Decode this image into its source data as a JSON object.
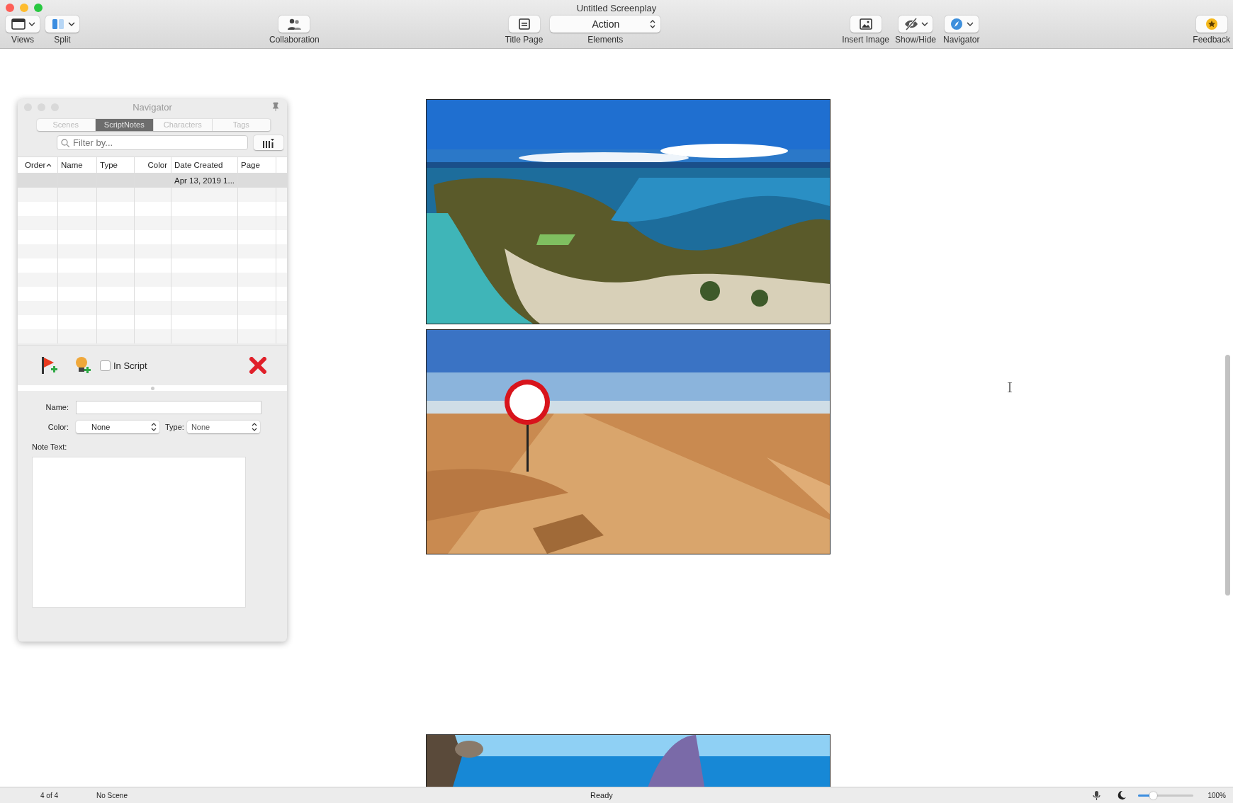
{
  "window": {
    "title": "Untitled Screenplay"
  },
  "toolbar": [
    {
      "kind": "button",
      "label": "Views",
      "menu": true
    },
    {
      "kind": "button",
      "label": "Split",
      "menu": true
    },
    {
      "kind": "button",
      "label": "Collaboration",
      "menu": false
    },
    {
      "kind": "button",
      "label": "Title Page",
      "menu": false
    },
    {
      "kind": "popup",
      "label": "Elements",
      "value": "Action"
    },
    {
      "kind": "button",
      "label": "Insert Image",
      "menu": false
    },
    {
      "kind": "button",
      "label": "Show/Hide",
      "menu": true
    },
    {
      "kind": "button",
      "label": "Navigator",
      "menu": true
    },
    {
      "kind": "button",
      "label": "Feedback",
      "menu": false
    }
  ],
  "navigator": {
    "title": "Navigator",
    "tabs": [
      {
        "label": "Scenes",
        "selected": false
      },
      {
        "label": "ScriptNotes",
        "selected": true
      },
      {
        "label": "Characters",
        "selected": false
      },
      {
        "label": "Tags",
        "selected": false
      }
    ],
    "filter": {
      "placeholder": "Filter by..."
    },
    "columns": [
      {
        "label": "Order",
        "sorted": true
      },
      {
        "label": "Name",
        "sorted": false
      },
      {
        "label": "Type",
        "sorted": false
      },
      {
        "label": "Color",
        "sorted": false
      },
      {
        "label": "Date Created",
        "sorted": false
      },
      {
        "label": "Page",
        "sorted": false
      }
    ],
    "rows": [
      {
        "selected": true,
        "date_created": "Apr 13, 2019 1..."
      }
    ],
    "in_script": {
      "label": "In Script",
      "checked": false
    },
    "form": {
      "name_label": "Name:",
      "color_label": "Color:",
      "color_value": "None",
      "type_label": "Type:",
      "type_value": "None",
      "note_label": "Note Text:"
    }
  },
  "status_bar": {
    "position": "4 of 4",
    "scene": "No Scene",
    "state": "Ready",
    "zoom": {
      "level": 0.28,
      "reading": "100%"
    }
  }
}
